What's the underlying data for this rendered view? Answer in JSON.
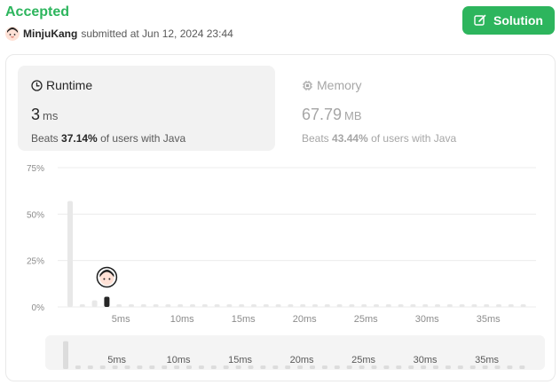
{
  "submission": {
    "status": "Accepted",
    "user": "MinjuKang",
    "submitted_text": "submitted at Jun 12, 2024 23:44"
  },
  "solution_button": {
    "label": "Solution",
    "icon": "edit-icon"
  },
  "runtime": {
    "title": "Runtime",
    "icon": "clock-icon",
    "value": "3",
    "unit": "ms",
    "beats_prefix": "Beats",
    "beats_pct": "37.14%",
    "beats_suffix": "of users with Java"
  },
  "memory": {
    "title": "Memory",
    "icon": "chip-icon",
    "value": "67.79",
    "unit": "MB",
    "beats_prefix": "Beats",
    "beats_pct": "43.44%",
    "beats_suffix": "of users with Java"
  },
  "colors": {
    "accent": "#2db55d",
    "bar": "#e8e8e8",
    "bar_selected": "#262626",
    "grid": "#ececec"
  },
  "chart_data": {
    "type": "bar",
    "title": "",
    "xlabel": "",
    "ylabel": "",
    "ylim": [
      0,
      75
    ],
    "y_ticks": [
      "0%",
      "25%",
      "50%",
      "75%"
    ],
    "x": [
      1,
      2,
      3,
      4,
      5,
      6,
      7,
      8,
      9,
      10,
      11,
      12,
      13,
      14,
      15,
      16,
      17,
      18,
      19,
      20,
      21,
      22,
      23,
      24,
      25,
      26,
      27,
      28,
      29,
      30,
      31,
      32,
      33,
      34,
      35,
      36,
      37,
      38
    ],
    "values": [
      57,
      1,
      3.5,
      5.5,
      1,
      1,
      1,
      1,
      1,
      1,
      1,
      1,
      1,
      1,
      1,
      1,
      1,
      1,
      1,
      1,
      1,
      1,
      1,
      1,
      1,
      1,
      1,
      1,
      1,
      1,
      1,
      1,
      1,
      1,
      1,
      1,
      1,
      1
    ],
    "selected_x": 4,
    "x_tick_labels": [
      "5ms",
      "10ms",
      "15ms",
      "20ms",
      "25ms",
      "30ms",
      "35ms"
    ],
    "x_tick_values": [
      5,
      10,
      15,
      20,
      25,
      30,
      35
    ]
  }
}
